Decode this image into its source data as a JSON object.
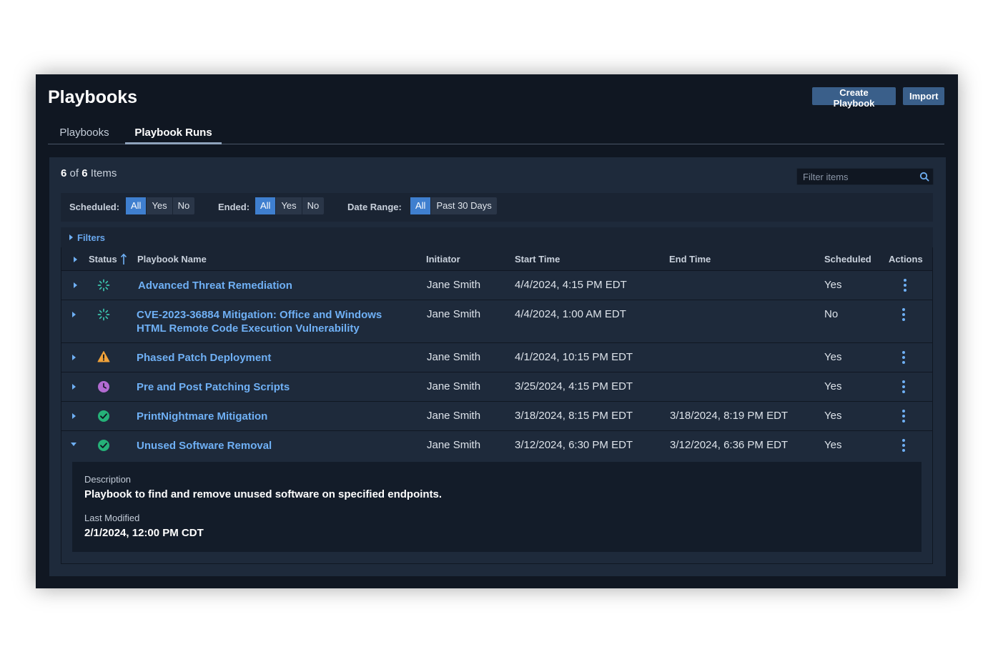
{
  "page": {
    "title": "Playbooks"
  },
  "header_buttons": {
    "create": "Create Playbook",
    "import": "Import"
  },
  "tabs": [
    {
      "label": "Playbooks",
      "active": false
    },
    {
      "label": "Playbook Runs",
      "active": true
    }
  ],
  "summary": {
    "shown": "6",
    "of": "of",
    "total": "6",
    "unit": "Items"
  },
  "filter": {
    "placeholder": "Filter items"
  },
  "quick_filters": {
    "scheduled": {
      "label": "Scheduled:",
      "options": [
        "All",
        "Yes",
        "No"
      ],
      "selected": "All"
    },
    "ended": {
      "label": "Ended:",
      "options": [
        "All",
        "Yes",
        "No"
      ],
      "selected": "All"
    },
    "date_range": {
      "label": "Date Range:",
      "options": [
        "All",
        "Past 30 Days"
      ],
      "selected": "All"
    }
  },
  "filters_toggle": "Filters",
  "columns": {
    "status": "Status",
    "name": "Playbook Name",
    "initiator": "Initiator",
    "start": "Start Time",
    "end": "End Time",
    "scheduled": "Scheduled",
    "actions": "Actions"
  },
  "colors": {
    "accent": "#6fb0f5",
    "running": "#3cc7b0",
    "warning": "#f0a23a",
    "scheduled": "#b26bd1",
    "success": "#25b178"
  },
  "rows": [
    {
      "status": "running-icon",
      "name_lines": [
        "Advanced Threat Remediation"
      ],
      "initiator": "Jane Smith",
      "start": "4/4/2024, 4:15 PM EDT",
      "end": "",
      "scheduled": "Yes",
      "expanded": false
    },
    {
      "status": "running-icon",
      "name_lines": [
        "CVE-2023-36884 Mitigation: Office and Windows",
        "HTML Remote Code Execution Vulnerability"
      ],
      "initiator": "Jane Smith",
      "start": "4/4/2024, 1:00 AM EDT",
      "end": "",
      "scheduled": "No",
      "expanded": false
    },
    {
      "status": "warning-icon",
      "name_lines": [
        "Phased Patch Deployment"
      ],
      "initiator": "Jane Smith",
      "start": "4/1/2024, 10:15 PM EDT",
      "end": "",
      "scheduled": "Yes",
      "expanded": false
    },
    {
      "status": "clock-icon",
      "name_lines": [
        "Pre and Post Patching Scripts"
      ],
      "initiator": "Jane Smith",
      "start": "3/25/2024, 4:15 PM EDT",
      "end": "",
      "scheduled": "Yes",
      "expanded": false
    },
    {
      "status": "check-circle-icon",
      "name_lines": [
        "PrintNightmare Mitigation"
      ],
      "initiator": "Jane Smith",
      "start": "3/18/2024, 8:15 PM EDT",
      "end": "3/18/2024, 8:19 PM EDT",
      "scheduled": "Yes",
      "expanded": false
    },
    {
      "status": "check-circle-icon",
      "name_lines": [
        "Unused Software Removal"
      ],
      "initiator": "Jane Smith",
      "start": "3/12/2024, 6:30 PM EDT",
      "end": "3/12/2024, 6:36 PM EDT",
      "scheduled": "Yes",
      "expanded": true
    }
  ],
  "detail": {
    "description_label": "Description",
    "description": "Playbook to find and remove unused software on specified endpoints.",
    "modified_label": "Last Modified",
    "modified": "2/1/2024, 12:00 PM CDT"
  }
}
